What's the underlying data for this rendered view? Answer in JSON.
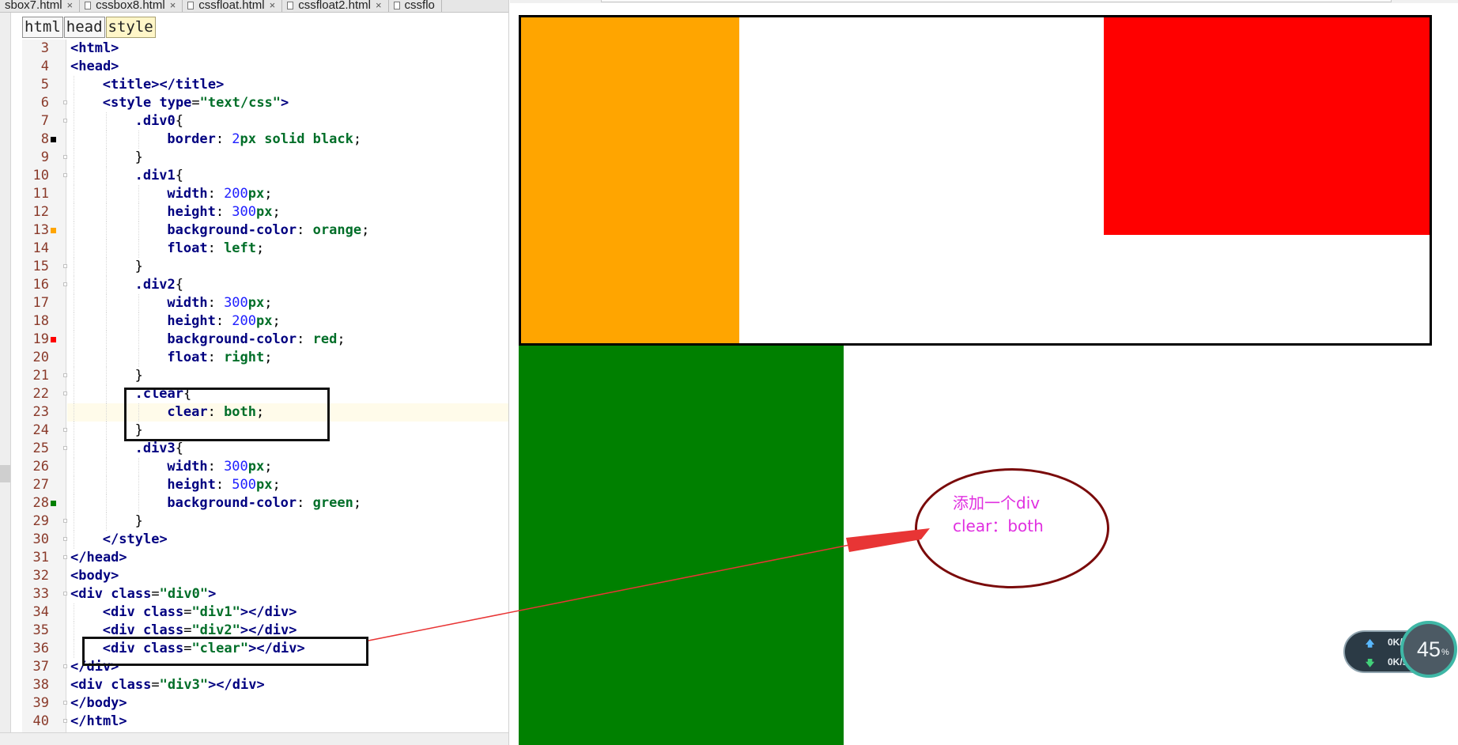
{
  "editor": {
    "tabs": [
      {
        "label": "sbox7.html"
      },
      {
        "label": "cssbox8.html"
      },
      {
        "label": "cssfloat.html"
      },
      {
        "label": "cssfloat2.html"
      },
      {
        "label": "cssflo"
      }
    ],
    "tab_close_glyph": "×",
    "breadcrumb": [
      "html",
      "head",
      "style"
    ],
    "line_numbers": [
      "3",
      "4",
      "5",
      "6",
      "7",
      "8",
      "9",
      "10",
      "11",
      "12",
      "13",
      "14",
      "15",
      "16",
      "17",
      "18",
      "19",
      "20",
      "21",
      "22",
      "23",
      "24",
      "25",
      "26",
      "27",
      "28",
      "29",
      "30",
      "31",
      "32",
      "33",
      "34",
      "35",
      "36",
      "37",
      "38",
      "39",
      "40"
    ],
    "gutter_color_marks": {
      "8": "#000000",
      "13": "#ffa500",
      "19": "#ff0000",
      "28": "#008000"
    },
    "highlighted_line": "23",
    "code_text": {
      "l3": "<html>",
      "l4": "<head>",
      "l5": "<title></title>",
      "l6a": "<style",
      "l6b": "type",
      "l6c": "=",
      "l6d": "\"text/css\"",
      "l6e": ">",
      "l7": ".div0",
      "l7b": "{",
      "l8a": "border",
      "l8b": ": ",
      "l8c": "2",
      "l8d": "px solid black",
      "l8e": ";",
      "l9": "}",
      "l10": ".div1",
      "l10b": "{",
      "l11a": "width",
      "l11b": ": ",
      "l11c": "200",
      "l11d": "px",
      "l11e": ";",
      "l12a": "height",
      "l12b": ": ",
      "l12c": "300",
      "l12d": "px",
      "l12e": ";",
      "l13a": "background-color",
      "l13b": ": ",
      "l13c": "orange",
      "l13d": ";",
      "l14a": "float",
      "l14b": ": ",
      "l14c": "left",
      "l14d": ";",
      "l15": "}",
      "l16": ".div2",
      "l16b": "{",
      "l17a": "width",
      "l17b": ": ",
      "l17c": "300",
      "l17d": "px",
      "l17e": ";",
      "l18a": "height",
      "l18b": ": ",
      "l18c": "200",
      "l18d": "px",
      "l18e": ";",
      "l19a": "background-color",
      "l19b": ": ",
      "l19c": "red",
      "l19d": ";",
      "l20a": "float",
      "l20b": ": ",
      "l20c": "right",
      "l20d": ";",
      "l21": "}",
      "l22": ".clear",
      "l22b": "{",
      "l23a": "clear",
      "l23b": ": ",
      "l23c": "both",
      "l23d": ";",
      "l24": "}",
      "l25": ".div3",
      "l25b": "{",
      "l26a": "width",
      "l26b": ": ",
      "l26c": "300",
      "l26d": "px",
      "l26e": ";",
      "l27a": "height",
      "l27b": ": ",
      "l27c": "500",
      "l27d": "px",
      "l27e": ";",
      "l28a": "background-color",
      "l28b": ": ",
      "l28c": "green",
      "l28d": ";",
      "l29": "}",
      "l30": "</style>",
      "l31": "</head>",
      "l32": "<body>",
      "l33a": "<div",
      "l33b": "class",
      "l33c": "=",
      "l33d": "\"div0\"",
      "l33e": ">",
      "l34a": "<div",
      "l34b": "class",
      "l34c": "=",
      "l34d": "\"div1\"",
      "l34e": "></div>",
      "l35a": "<div",
      "l35b": "class",
      "l35c": "=",
      "l35d": "\"div2\"",
      "l35e": "></div>",
      "l36a": "<div",
      "l36b": "class",
      "l36c": "=",
      "l36d": "\"clear\"",
      "l36e": "></div>",
      "l37": "</div>",
      "l38a": "<div",
      "l38b": "class",
      "l38c": "=",
      "l38d": "\"div3\"",
      "l38e": "></div>",
      "l39": "</body>",
      "l40": "</html>"
    }
  },
  "preview": {
    "annotation_line1": "添加一个div",
    "annotation_line2": "clear：both",
    "colors": {
      "div1": "#ffa500",
      "div2": "#ff0000",
      "div3": "#008000",
      "arrow": "#e83535",
      "ellipse": "#7a0a0a",
      "annotation_text": "#e030e0"
    }
  },
  "net_widget": {
    "upload_icon": "arrow-up-icon",
    "download_icon": "arrow-down-icon",
    "upload": "0K/s",
    "download": "0K/s",
    "load_value": "45",
    "load_unit": "%"
  }
}
